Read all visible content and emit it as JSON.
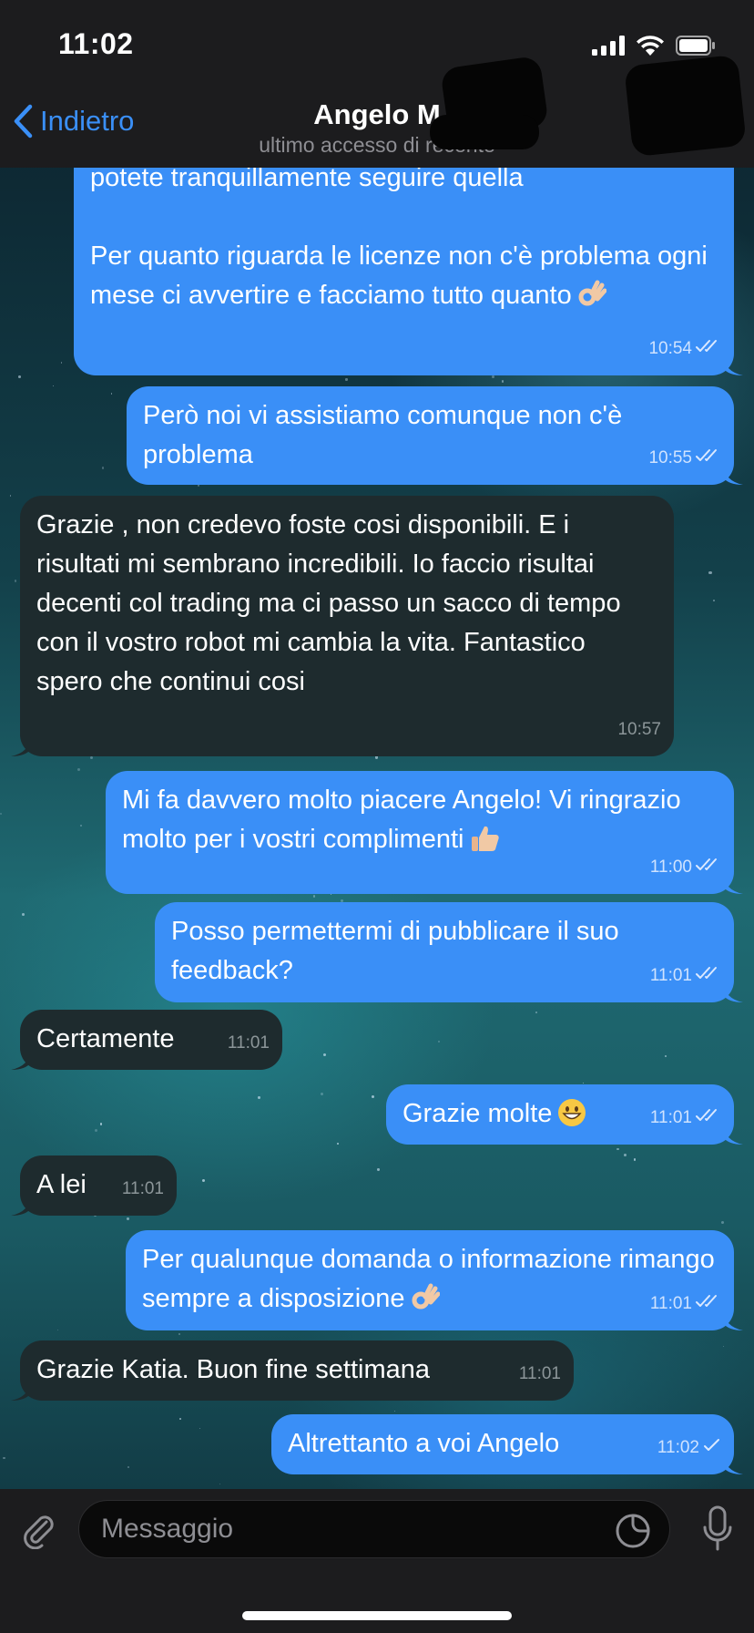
{
  "status_bar": {
    "time": "11:02",
    "signal_icon": "signal-icon",
    "wifi_icon": "wifi-icon",
    "battery_icon": "battery-icon"
  },
  "header": {
    "back_label": "Indietro",
    "contact_name": "Angelo M",
    "status": "ultimo accesso di recente"
  },
  "colors": {
    "outgoing": "#3a8ff7",
    "incoming": "#1e2b2e",
    "accent": "#3a8ff7"
  },
  "messages": [
    {
      "dir": "out",
      "text": "potete tranquillamente seguire quella\n\nPer quanto riguarda le licenze non c'è problema ogni mese ci avvertire e facciamo tutto quanto",
      "emoji": "ok-hand",
      "time": "10:54",
      "ticks": "read"
    },
    {
      "dir": "out",
      "text": "Però noi vi assistiamo comunque non c'è problema",
      "time": "10:55",
      "ticks": "read"
    },
    {
      "dir": "in",
      "text": "Grazie , non credevo foste cosi disponibili. E i risultati mi sembrano incredibili. Io faccio risultai decenti col trading ma ci passo un sacco di tempo con il vostro robot mi cambia la vita. Fantastico spero che continui cosi",
      "time": "10:57"
    },
    {
      "dir": "out",
      "text": "Mi fa davvero molto piacere Angelo! Vi ringrazio molto per i vostri complimenti",
      "emoji": "thumbs-up",
      "time": "11:00",
      "ticks": "read"
    },
    {
      "dir": "out",
      "text": "Posso permettermi di pubblicare il suo feedback?",
      "time": "11:01",
      "ticks": "read"
    },
    {
      "dir": "in",
      "text": "Certamente",
      "time": "11:01"
    },
    {
      "dir": "out",
      "text": "Grazie molte",
      "emoji": "grin",
      "time": "11:01",
      "ticks": "read"
    },
    {
      "dir": "in",
      "text": "A lei",
      "time": "11:01"
    },
    {
      "dir": "out",
      "text": "Per qualunque domanda o informazione rimango sempre a disposizione",
      "emoji": "ok-hand",
      "time": "11:01",
      "ticks": "read"
    },
    {
      "dir": "in",
      "text": "Grazie Katia. Buon fine settimana",
      "time": "11:01"
    },
    {
      "dir": "out",
      "text": "Altrettanto a voi Angelo",
      "time": "11:02",
      "ticks": "sent"
    }
  ],
  "input": {
    "placeholder": "Messaggio",
    "attach_icon": "paperclip-icon",
    "sticker_icon": "sticker-icon",
    "mic_icon": "microphone-icon"
  }
}
